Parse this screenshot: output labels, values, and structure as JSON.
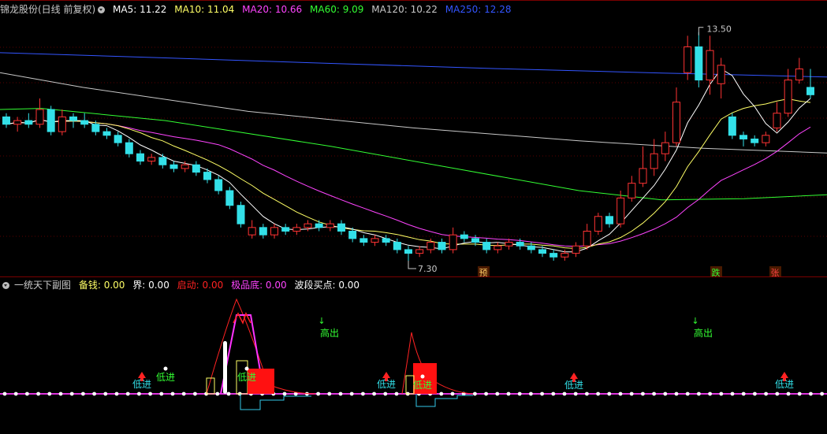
{
  "main_header": {
    "title": "锦龙股份(日线 前复权)",
    "ma5": "MA5: 11.22",
    "ma10": "MA10: 11.04",
    "ma20": "MA20: 10.66",
    "ma60": "MA60: 9.09",
    "ma120": "MA120: 10.22",
    "ma250": "MA250: 12.28",
    "colors": {
      "title": "#c8c8c8",
      "ma5": "#ffffff",
      "ma10": "#ffff66",
      "ma20": "#ff44ff",
      "ma60": "#33ff33",
      "ma120": "#c8c8c8",
      "ma250": "#3355ff"
    }
  },
  "sub_header": {
    "title": "一统天下副图",
    "beiqian": "备钱: 0.00",
    "jie": "界: 0.00",
    "qidong": "启动: 0.00",
    "jipindi": "极品底: 0.00",
    "boduan": "波段买点: 0.00",
    "colors": {
      "title": "#c8c8c8",
      "beiqian": "#ffff66",
      "jie": "#ffffff",
      "qidong": "#ff2222",
      "jipindi": "#ff44ff",
      "boduan": "#ffffff"
    }
  },
  "annotations": {
    "high_label": "13.50",
    "low_label": "7.30",
    "marker_yu": "预",
    "marker_die": "跌",
    "marker_zhang": "张"
  },
  "signals": {
    "low_entry": "低进",
    "high_exit": "高出",
    "up_arrow": "↑",
    "down_arrow": "↓"
  },
  "candles": [
    [
      11.2,
      11.0,
      11.3,
      10.9
    ],
    [
      11.0,
      11.1,
      11.2,
      10.8
    ],
    [
      11.1,
      11.0,
      11.3,
      10.9
    ],
    [
      11.0,
      11.4,
      11.7,
      10.9
    ],
    [
      11.4,
      10.8,
      11.5,
      10.7
    ],
    [
      10.8,
      11.2,
      11.4,
      10.7
    ],
    [
      11.2,
      11.1,
      11.3,
      10.9
    ],
    [
      11.1,
      11.0,
      11.3,
      10.9
    ],
    [
      11.0,
      10.8,
      11.1,
      10.7
    ],
    [
      10.8,
      10.7,
      10.9,
      10.6
    ],
    [
      10.7,
      10.5,
      10.8,
      10.4
    ],
    [
      10.5,
      10.2,
      10.6,
      10.1
    ],
    [
      10.2,
      10.0,
      10.3,
      9.9
    ],
    [
      10.0,
      10.1,
      10.2,
      9.9
    ],
    [
      10.1,
      9.9,
      10.2,
      9.8
    ],
    [
      9.9,
      9.8,
      10.0,
      9.7
    ],
    [
      9.8,
      9.9,
      10.0,
      9.7
    ],
    [
      9.9,
      9.7,
      10.0,
      9.6
    ],
    [
      9.7,
      9.5,
      9.8,
      9.4
    ],
    [
      9.5,
      9.2,
      9.6,
      9.1
    ],
    [
      9.2,
      8.8,
      9.3,
      8.7
    ],
    [
      8.8,
      8.3,
      8.9,
      8.2
    ],
    [
      8.0,
      8.2,
      8.4,
      7.9
    ],
    [
      8.2,
      8.0,
      8.3,
      7.9
    ],
    [
      8.0,
      8.2,
      8.3,
      7.9
    ],
    [
      8.2,
      8.1,
      8.3,
      8.0
    ],
    [
      8.1,
      8.2,
      8.3,
      8.0
    ],
    [
      8.2,
      8.3,
      8.4,
      8.1
    ],
    [
      8.3,
      8.2,
      8.4,
      8.1
    ],
    [
      8.2,
      8.3,
      8.4,
      8.1
    ],
    [
      8.3,
      8.1,
      8.4,
      8.0
    ],
    [
      8.1,
      7.9,
      8.2,
      7.8
    ],
    [
      7.9,
      7.8,
      8.0,
      7.7
    ],
    [
      7.8,
      7.9,
      8.0,
      7.7
    ],
    [
      7.9,
      7.8,
      8.0,
      7.7
    ],
    [
      7.8,
      7.6,
      7.9,
      7.5
    ],
    [
      7.6,
      7.5,
      7.7,
      7.3
    ],
    [
      7.5,
      7.6,
      7.7,
      7.4
    ],
    [
      7.6,
      7.8,
      7.9,
      7.5
    ],
    [
      7.8,
      7.6,
      7.9,
      7.5
    ],
    [
      7.6,
      8.0,
      8.2,
      7.5
    ],
    [
      8.0,
      7.9,
      8.1,
      7.8
    ],
    [
      7.9,
      7.8,
      8.0,
      7.7
    ],
    [
      7.8,
      7.6,
      7.9,
      7.5
    ],
    [
      7.6,
      7.7,
      7.8,
      7.5
    ],
    [
      7.7,
      7.8,
      7.9,
      7.6
    ],
    [
      7.8,
      7.7,
      7.9,
      7.6
    ],
    [
      7.7,
      7.6,
      7.8,
      7.5
    ],
    [
      7.6,
      7.5,
      7.7,
      7.4
    ],
    [
      7.5,
      7.4,
      7.6,
      7.3
    ],
    [
      7.4,
      7.5,
      7.6,
      7.3
    ],
    [
      7.5,
      7.7,
      7.8,
      7.4
    ],
    [
      7.7,
      8.1,
      8.3,
      7.6
    ],
    [
      8.1,
      8.5,
      8.6,
      8.0
    ],
    [
      8.5,
      8.3,
      8.6,
      8.2
    ],
    [
      8.3,
      9.0,
      9.2,
      8.2
    ],
    [
      9.0,
      9.4,
      9.6,
      8.9
    ],
    [
      9.4,
      9.8,
      10.4,
      9.3
    ],
    [
      9.8,
      10.2,
      10.6,
      9.6
    ],
    [
      10.2,
      10.5,
      10.8,
      10.0
    ],
    [
      10.5,
      11.6,
      12.0,
      10.4
    ],
    [
      12.4,
      13.1,
      13.4,
      12.2
    ],
    [
      13.1,
      12.2,
      13.5,
      12.0
    ],
    [
      12.2,
      13.0,
      13.4,
      11.8
    ],
    [
      12.1,
      12.6,
      12.8,
      11.7
    ],
    [
      11.2,
      10.7,
      11.3,
      10.6
    ],
    [
      10.7,
      10.6,
      10.8,
      10.4
    ],
    [
      10.6,
      10.5,
      10.7,
      10.4
    ],
    [
      10.5,
      10.7,
      10.8,
      10.4
    ],
    [
      10.9,
      11.3,
      11.6,
      10.8
    ],
    [
      11.3,
      12.2,
      12.5,
      11.2
    ],
    [
      12.2,
      12.5,
      12.8,
      12.1
    ],
    [
      12.0,
      11.8,
      12.5,
      11.7
    ]
  ],
  "ma_lines": {
    "ma250": [
      [
        0,
        12.94
      ],
      [
        0.2,
        12.8
      ],
      [
        0.4,
        12.65
      ],
      [
        0.6,
        12.51
      ],
      [
        0.8,
        12.39
      ],
      [
        1.0,
        12.28
      ]
    ],
    "ma120": [
      [
        0,
        12.4
      ],
      [
        0.1,
        12.0
      ],
      [
        0.3,
        11.35
      ],
      [
        0.5,
        10.9
      ],
      [
        0.7,
        10.55
      ],
      [
        0.85,
        10.35
      ],
      [
        1.0,
        10.22
      ]
    ],
    "ma60": [
      [
        0,
        11.4
      ],
      [
        0.05,
        11.43
      ],
      [
        0.2,
        11.1
      ],
      [
        0.4,
        10.4
      ],
      [
        0.55,
        9.8
      ],
      [
        0.7,
        9.2
      ],
      [
        0.8,
        8.95
      ],
      [
        0.9,
        8.98
      ],
      [
        1.0,
        9.09
      ]
    ]
  }
}
